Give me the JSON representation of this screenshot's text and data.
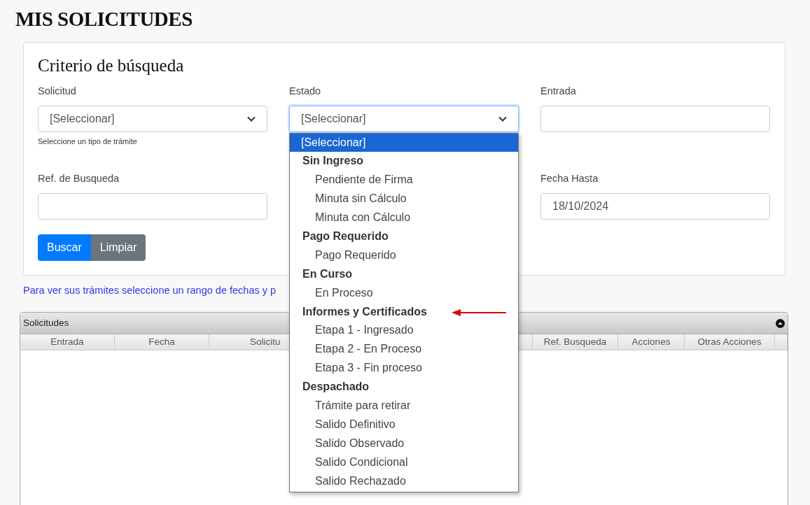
{
  "page_title": "MIS SOLICITUDES",
  "search_card": {
    "title": "Criterio de búsqueda",
    "fields": [
      {
        "kind": "select",
        "label": "Solicitud",
        "value": "[Seleccionar]",
        "help": "Seleccione un tipo de trámite",
        "focused": false
      },
      {
        "kind": "select",
        "label": "Estado",
        "value": "[Seleccionar]",
        "focused": true,
        "open": true
      },
      {
        "kind": "text",
        "label": "Entrada"
      },
      {
        "kind": "text",
        "label": "Ref. de Busqueda"
      },
      {
        "kind": "covered"
      },
      {
        "kind": "text",
        "label": "Fecha Hasta",
        "value": "18/10/2024"
      }
    ],
    "buttons": [
      {
        "label": "Buscar",
        "kind": "primary"
      },
      {
        "label": "Limpiar",
        "kind": "secondary"
      }
    ]
  },
  "note": "Para ver sus trámites seleccione un rango de fechas y p",
  "grid": {
    "title": "Solicitudes",
    "columns": [
      "Entrada",
      "Fecha",
      "Solicitu",
      "",
      "Ref. Busqueda",
      "Acciones",
      "Otras Acciones"
    ]
  },
  "dropdown": {
    "items": [
      {
        "kind": "option",
        "label": "[Seleccionar]",
        "selected": true
      },
      {
        "kind": "group",
        "label": "Sin Ingreso",
        "children": [
          {
            "label": "Pendiente de Firma",
            "selected": false
          },
          {
            "label": "Minuta sin Cálculo",
            "selected": false
          },
          {
            "label": "Minuta con Cálculo",
            "selected": false
          }
        ]
      },
      {
        "kind": "group",
        "label": "Pago Requerido",
        "children": [
          {
            "label": "Pago Requerido",
            "selected": false
          }
        ]
      },
      {
        "kind": "group",
        "label": "En Curso",
        "children": [
          {
            "label": "En Proceso",
            "selected": false
          }
        ]
      },
      {
        "kind": "group",
        "label": "Informes y Certificados",
        "pointed": true,
        "children": [
          {
            "label": "Etapa 1 - Ingresado",
            "selected": false
          },
          {
            "label": "Etapa 2 - En Proceso",
            "selected": false
          },
          {
            "label": "Etapa 3 - Fin proceso",
            "selected": false
          }
        ]
      },
      {
        "kind": "group",
        "label": "Despachado",
        "children": [
          {
            "label": "Trámite para retirar",
            "selected": false
          },
          {
            "label": "Salido Definitivo",
            "selected": false
          },
          {
            "label": "Salido Observado",
            "selected": false
          },
          {
            "label": "Salido Condicional",
            "selected": false
          },
          {
            "label": "Salido Rechazado",
            "selected": false
          }
        ]
      }
    ]
  }
}
